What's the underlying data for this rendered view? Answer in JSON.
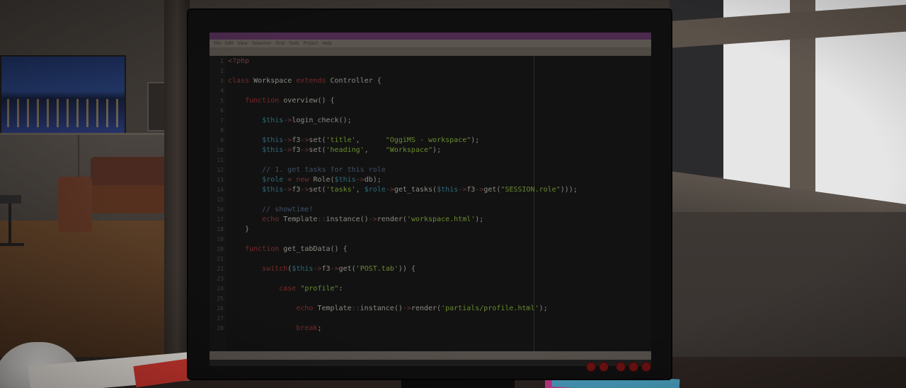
{
  "editor": {
    "title": "",
    "menu": [
      "File",
      "Edit",
      "View",
      "Selection",
      "Find",
      "Tools",
      "Project",
      "Help"
    ],
    "tab": "",
    "lines": [
      {
        "n": "1",
        "segments": [
          {
            "c": "op",
            "t": "<?php"
          }
        ]
      },
      {
        "n": "2",
        "segments": []
      },
      {
        "n": "3",
        "segments": [
          {
            "c": "kw",
            "t": "class "
          },
          {
            "c": "fn",
            "t": "Workspace "
          },
          {
            "c": "kw",
            "t": "extends "
          },
          {
            "c": "fn",
            "t": "Controller {"
          }
        ]
      },
      {
        "n": "4",
        "segments": []
      },
      {
        "n": "5",
        "segments": [
          {
            "c": "fn",
            "t": "    "
          },
          {
            "c": "kw",
            "t": "function "
          },
          {
            "c": "fn",
            "t": "overview() {"
          }
        ]
      },
      {
        "n": "6",
        "segments": []
      },
      {
        "n": "7",
        "segments": [
          {
            "c": "fn",
            "t": "        "
          },
          {
            "c": "var",
            "t": "$this"
          },
          {
            "c": "op",
            "t": "->"
          },
          {
            "c": "fn",
            "t": "login_check();"
          }
        ]
      },
      {
        "n": "8",
        "segments": []
      },
      {
        "n": "9",
        "segments": [
          {
            "c": "fn",
            "t": "        "
          },
          {
            "c": "var",
            "t": "$this"
          },
          {
            "c": "op",
            "t": "->"
          },
          {
            "c": "fn",
            "t": "f3"
          },
          {
            "c": "op",
            "t": "->"
          },
          {
            "c": "fn",
            "t": "set("
          },
          {
            "c": "str",
            "t": "'title'"
          },
          {
            "c": "fn",
            "t": ",      "
          },
          {
            "c": "str",
            "t": "\"OggiMS - workspace\""
          },
          {
            "c": "fn",
            "t": ");"
          }
        ]
      },
      {
        "n": "10",
        "segments": [
          {
            "c": "fn",
            "t": "        "
          },
          {
            "c": "var",
            "t": "$this"
          },
          {
            "c": "op",
            "t": "->"
          },
          {
            "c": "fn",
            "t": "f3"
          },
          {
            "c": "op",
            "t": "->"
          },
          {
            "c": "fn",
            "t": "set("
          },
          {
            "c": "str",
            "t": "'heading'"
          },
          {
            "c": "fn",
            "t": ",    "
          },
          {
            "c": "str",
            "t": "\"Workspace\""
          },
          {
            "c": "fn",
            "t": ");"
          }
        ]
      },
      {
        "n": "11",
        "segments": []
      },
      {
        "n": "12",
        "segments": [
          {
            "c": "cm",
            "t": "        // 1. get tasks for this role"
          }
        ]
      },
      {
        "n": "13",
        "segments": [
          {
            "c": "fn",
            "t": "        "
          },
          {
            "c": "var",
            "t": "$role"
          },
          {
            "c": "op",
            "t": " = "
          },
          {
            "c": "kw",
            "t": "new "
          },
          {
            "c": "fn",
            "t": "Role("
          },
          {
            "c": "var",
            "t": "$this"
          },
          {
            "c": "op",
            "t": "->"
          },
          {
            "c": "fn",
            "t": "db);"
          }
        ]
      },
      {
        "n": "14",
        "segments": [
          {
            "c": "fn",
            "t": "        "
          },
          {
            "c": "var",
            "t": "$this"
          },
          {
            "c": "op",
            "t": "->"
          },
          {
            "c": "fn",
            "t": "f3"
          },
          {
            "c": "op",
            "t": "->"
          },
          {
            "c": "fn",
            "t": "set("
          },
          {
            "c": "str",
            "t": "'tasks'"
          },
          {
            "c": "fn",
            "t": ", "
          },
          {
            "c": "var",
            "t": "$role"
          },
          {
            "c": "op",
            "t": "->"
          },
          {
            "c": "fn",
            "t": "get_tasks("
          },
          {
            "c": "var",
            "t": "$this"
          },
          {
            "c": "op",
            "t": "->"
          },
          {
            "c": "fn",
            "t": "f3"
          },
          {
            "c": "op",
            "t": "->"
          },
          {
            "c": "fn",
            "t": "get("
          },
          {
            "c": "str",
            "t": "\"SESSION.role\""
          },
          {
            "c": "fn",
            "t": ")));"
          }
        ]
      },
      {
        "n": "15",
        "segments": []
      },
      {
        "n": "16",
        "segments": [
          {
            "c": "cm",
            "t": "        // showtime!"
          }
        ]
      },
      {
        "n": "17",
        "segments": [
          {
            "c": "fn",
            "t": "        "
          },
          {
            "c": "kw",
            "t": "echo "
          },
          {
            "c": "fn",
            "t": "Template"
          },
          {
            "c": "op",
            "t": "::"
          },
          {
            "c": "fn",
            "t": "instance()"
          },
          {
            "c": "op",
            "t": "->"
          },
          {
            "c": "fn",
            "t": "render("
          },
          {
            "c": "str",
            "t": "'workspace.html'"
          },
          {
            "c": "fn",
            "t": ");"
          }
        ]
      },
      {
        "n": "18",
        "segments": [
          {
            "c": "fn",
            "t": "    }"
          }
        ]
      },
      {
        "n": "19",
        "segments": []
      },
      {
        "n": "20",
        "segments": [
          {
            "c": "fn",
            "t": "    "
          },
          {
            "c": "kw",
            "t": "function "
          },
          {
            "c": "fn",
            "t": "get_tabData() {"
          }
        ]
      },
      {
        "n": "21",
        "segments": []
      },
      {
        "n": "22",
        "segments": [
          {
            "c": "fn",
            "t": "        "
          },
          {
            "c": "kw",
            "t": "switch"
          },
          {
            "c": "fn",
            "t": "("
          },
          {
            "c": "var",
            "t": "$this"
          },
          {
            "c": "op",
            "t": "->"
          },
          {
            "c": "fn",
            "t": "f3"
          },
          {
            "c": "op",
            "t": "->"
          },
          {
            "c": "fn",
            "t": "get("
          },
          {
            "c": "str",
            "t": "'POST.tab'"
          },
          {
            "c": "fn",
            "t": ")) {"
          }
        ]
      },
      {
        "n": "23",
        "segments": []
      },
      {
        "n": "24",
        "segments": [
          {
            "c": "fn",
            "t": "            "
          },
          {
            "c": "kw",
            "t": "case "
          },
          {
            "c": "str",
            "t": "\"profile\""
          },
          {
            "c": "fn",
            "t": ":"
          }
        ]
      },
      {
        "n": "25",
        "segments": []
      },
      {
        "n": "26",
        "segments": [
          {
            "c": "fn",
            "t": "                "
          },
          {
            "c": "kw",
            "t": "echo "
          },
          {
            "c": "fn",
            "t": "Template"
          },
          {
            "c": "op",
            "t": "::"
          },
          {
            "c": "fn",
            "t": "instance()"
          },
          {
            "c": "op",
            "t": "->"
          },
          {
            "c": "fn",
            "t": "render("
          },
          {
            "c": "str",
            "t": "'partials/profile.html'"
          },
          {
            "c": "fn",
            "t": ");"
          }
        ]
      },
      {
        "n": "27",
        "segments": []
      },
      {
        "n": "28",
        "segments": [
          {
            "c": "fn",
            "t": "                "
          },
          {
            "c": "kw",
            "t": "break"
          },
          {
            "c": "fn",
            "t": ";"
          }
        ]
      }
    ]
  },
  "colors": {
    "titlebar": "#4b2a4d",
    "keyword": "#7a2a2c",
    "variable": "#2e6a76",
    "string": "#6a8a30",
    "comment": "#3f5066",
    "monitor_button": "#6b1212"
  }
}
